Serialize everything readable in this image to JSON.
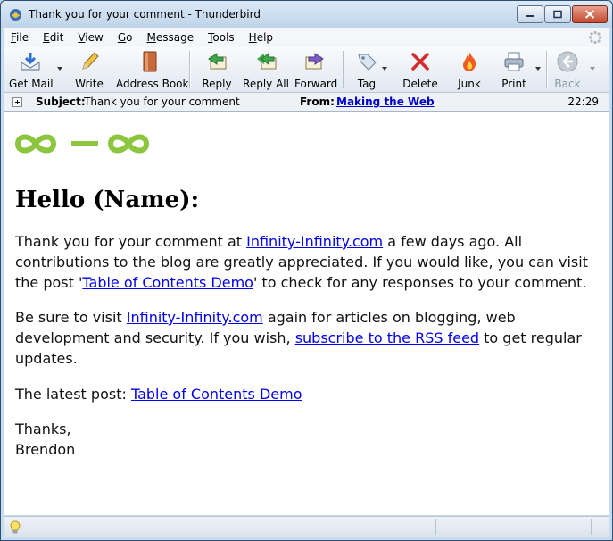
{
  "window": {
    "title": "Thank you for your comment - Thunderbird"
  },
  "menu": [
    "File",
    "Edit",
    "View",
    "Go",
    "Message",
    "Tools",
    "Help"
  ],
  "toolbar": {
    "get_mail": "Get Mail",
    "write": "Write",
    "address_book": "Address Book",
    "reply": "Reply",
    "reply_all": "Reply All",
    "forward": "Forward",
    "tag": "Tag",
    "delete": "Delete",
    "junk": "Junk",
    "print": "Print",
    "back": "Back"
  },
  "header": {
    "subject_label": "Subject:",
    "subject": "Thank you for your comment",
    "from_label": "From:",
    "from": "Making the Web",
    "time": "22:29"
  },
  "message": {
    "logo_color": "#8cc63f",
    "greeting": "Hello (Name):",
    "p1_a": "Thank you for your comment at ",
    "p1_link": "Infinity-Infinity.com",
    "p1_b": " a few days ago. All contributions to the blog are greatly appreciated. If you would like, you can visit the post '",
    "p1_link2": "Table of Contents Demo",
    "p1_c": "' to check for any responses to your comment.",
    "p2_a": "Be sure to visit ",
    "p2_link": "Infinity-Infinity.com",
    "p2_b": " again for articles on blogging, web development and security. If you wish, ",
    "p2_link2": "subscribe to the RSS feed",
    "p2_c": " to get regular updates.",
    "p3_a": "The latest post: ",
    "p3_link": "Table of Contents Demo",
    "sign_1": "Thanks,",
    "sign_2": "Brendon"
  },
  "colors": {
    "link": "#0000ee",
    "accent": "#8cc63f"
  }
}
